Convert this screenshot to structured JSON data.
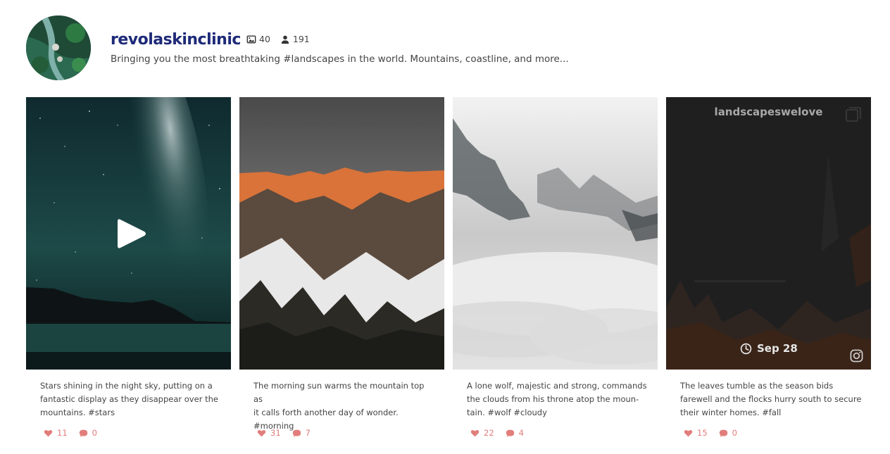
{
  "profile": {
    "username": "revolaskinclinic",
    "posts_count": "40",
    "followers_count": "191",
    "bio": "Bringing you the most breathtaking #landscapes in the world. Mountains, coastline, and more..."
  },
  "posts": [
    {
      "caption_lines": [
        "Stars shining in the night sky, putting on a",
        "fantastic display as they disappear over the",
        "mountains. #stars"
      ],
      "likes": "11",
      "comments": "0",
      "type": "video"
    },
    {
      "caption_lines": [
        "The morning sun warms the mountain top as",
        "it calls forth another day of wonder.",
        "#morning"
      ],
      "likes": "31",
      "comments": "7",
      "type": "image"
    },
    {
      "caption_lines": [
        "A lone wolf, majestic and strong, commands",
        "the clouds from his throne atop the moun-",
        "tain. #wolf #cloudy"
      ],
      "likes": "22",
      "comments": "4",
      "type": "image"
    },
    {
      "caption_lines": [
        "The leaves tumble as the season bids",
        "farewell and the flocks hurry south to secure",
        "their winter homes. #fall"
      ],
      "likes": "15",
      "comments": "0",
      "type": "carousel",
      "brand": "landscapeswelove",
      "date": "Sep 28"
    }
  ],
  "icons": [
    "image-icon",
    "user-icon",
    "heart-icon",
    "comment-icon",
    "play-icon",
    "carousel-icon",
    "clock-icon",
    "instagram-icon"
  ],
  "colors": {
    "username": "#1e2a78",
    "meta": "#e17e7b",
    "text": "#444444"
  }
}
